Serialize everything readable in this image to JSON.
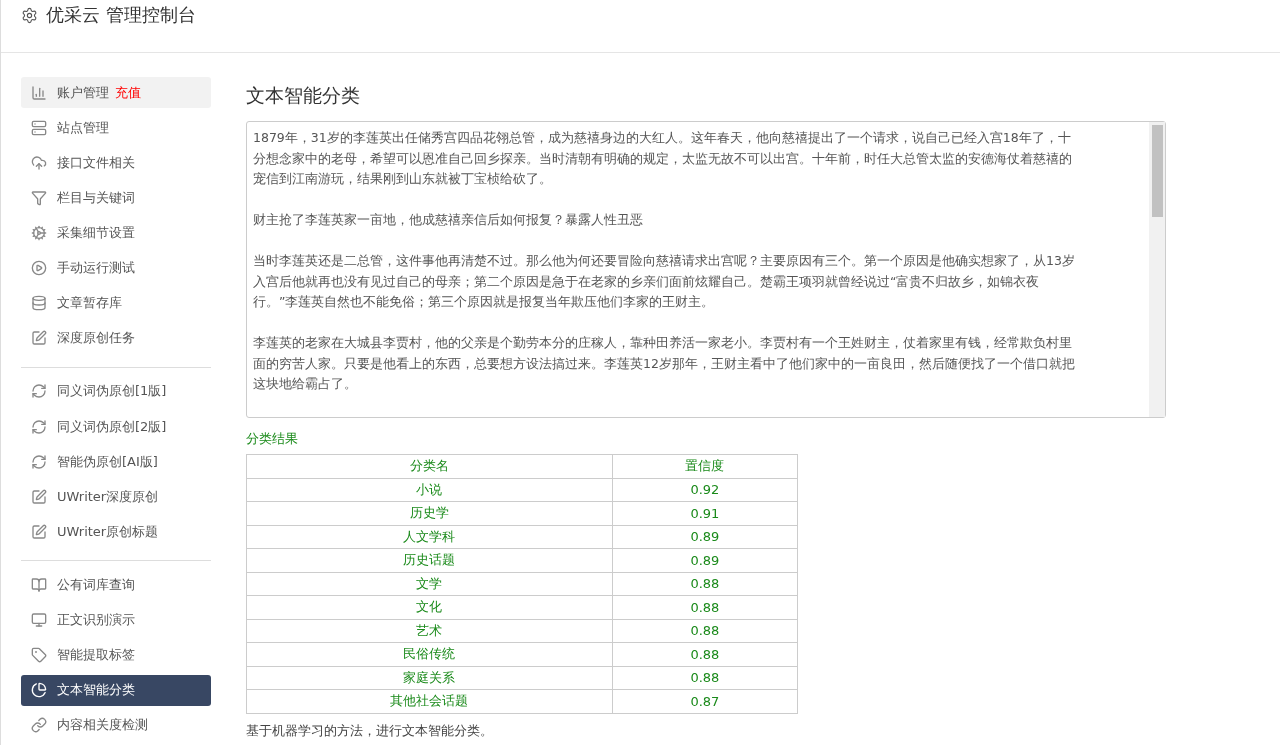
{
  "header": {
    "title": "优采云 管理控制台"
  },
  "sidebar": {
    "groups": [
      {
        "items": [
          {
            "kind": "chart",
            "label": "账户管理",
            "badge": "充值",
            "highlighted": true,
            "selected": false
          },
          {
            "kind": "server",
            "label": "站点管理",
            "highlighted": false,
            "selected": false
          },
          {
            "kind": "cloud",
            "label": "接口文件相关",
            "highlighted": false,
            "selected": false
          },
          {
            "kind": "filter",
            "label": "栏目与关键词",
            "highlighted": false,
            "selected": false
          },
          {
            "kind": "gears",
            "label": "采集细节设置",
            "highlighted": false,
            "selected": false
          },
          {
            "kind": "play",
            "label": "手动运行测试",
            "highlighted": false,
            "selected": false
          },
          {
            "kind": "database",
            "label": "文章暂存库",
            "highlighted": false,
            "selected": false
          },
          {
            "kind": "edit",
            "label": "深度原创任务",
            "highlighted": false,
            "selected": false
          }
        ]
      },
      {
        "items": [
          {
            "kind": "refresh",
            "label": "同义词伪原创[1版]",
            "highlighted": false,
            "selected": false
          },
          {
            "kind": "refresh",
            "label": "同义词伪原创[2版]",
            "highlighted": false,
            "selected": false
          },
          {
            "kind": "refresh",
            "label": "智能伪原创[AI版]",
            "highlighted": false,
            "selected": false
          },
          {
            "kind": "edit",
            "label": "UWriter深度原创",
            "highlighted": false,
            "selected": false
          },
          {
            "kind": "edit",
            "label": "UWriter原创标题",
            "highlighted": false,
            "selected": false
          }
        ]
      },
      {
        "items": [
          {
            "kind": "book",
            "label": "公有词库查询",
            "highlighted": false,
            "selected": false
          },
          {
            "kind": "monitor",
            "label": "正文识别演示",
            "highlighted": false,
            "selected": false
          },
          {
            "kind": "tag",
            "label": "智能提取标签",
            "highlighted": false,
            "selected": false
          },
          {
            "kind": "pie",
            "label": "文本智能分类",
            "highlighted": false,
            "selected": true
          },
          {
            "kind": "link",
            "label": "内容相关度检测",
            "highlighted": false,
            "selected": false
          }
        ]
      }
    ]
  },
  "main": {
    "title": "文本智能分类",
    "text_area": {
      "paragraphs": [
        [
          "1879年，31岁的李莲英出任储秀宫四品花翎总管，成为慈禧身边的大红人。这年春天，他向慈禧提出了一个请求，说自己已经入宫18年了，十",
          "分想念家中的老母，希望可以恩准自己回乡探亲。当时清朝有明确的规定，太监无故不可以出宫。十年前，时任大总管太监的安德海仗着慈禧的",
          "宠信到江南游玩，结果刚到山东就被丁宝桢给砍了。"
        ],
        [
          "财主抢了李莲英家一亩地，他成慈禧亲信后如何报复？暴露人性丑恶"
        ],
        [
          "当时李莲英还是二总管，这件事他再清楚不过。那么他为何还要冒险向慈禧请求出宫呢？主要原因有三个。第一个原因是他确实想家了，从13岁",
          "入宫后他就再也没有见过自己的母亲；第二个原因是急于在老家的乡亲们面前炫耀自己。楚霸王项羽就曾经说过“富贵不归故乡，如锦衣夜",
          "行。”李莲英自然也不能免俗；第三个原因就是报复当年欺压他们李家的王财主。"
        ],
        [
          "李莲英的老家在大城县李贾村，他的父亲是个勤劳本分的庄稼人，靠种田养活一家老小。李贾村有一个王姓财主，仗着家里有钱，经常欺负村里",
          "面的穷苦人家。只要是他看上的东西，总要想方设法搞过来。李莲英12岁那年，王财主看中了他们家中的一亩良田，然后随便找了一个借口就把",
          "这块地给霸占了。"
        ]
      ]
    },
    "result_label": "分类结果",
    "table": {
      "columns": [
        "分类名",
        "置信度"
      ],
      "rows": [
        [
          "小说",
          "0.92"
        ],
        [
          "历史学",
          "0.91"
        ],
        [
          "人文学科",
          "0.89"
        ],
        [
          "历史话题",
          "0.89"
        ],
        [
          "文学",
          "0.88"
        ],
        [
          "文化",
          "0.88"
        ],
        [
          "艺术",
          "0.88"
        ],
        [
          "民俗传统",
          "0.88"
        ],
        [
          "家庭关系",
          "0.88"
        ],
        [
          "其他社会话题",
          "0.87"
        ]
      ]
    },
    "note": "基于机器学习的方法，进行文本智能分类。"
  }
}
